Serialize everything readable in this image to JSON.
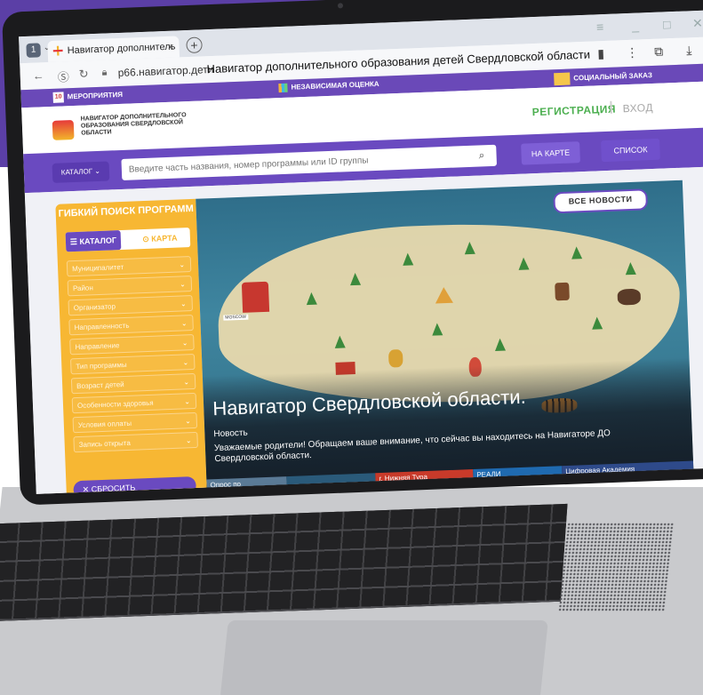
{
  "browser": {
    "tab_title": "Навигатор дополнитель",
    "url": "р66.навигатор.дети",
    "page_title": "Навигатор дополнительного образования детей Свердловской области",
    "tab_close": "×",
    "new_tab": "+"
  },
  "topstrip": {
    "events_day": "10",
    "events": "МЕРОПРИЯТИЯ",
    "independent": "НЕЗАВИСИМАЯ ОЦЕНКА",
    "social": "СОЦИАЛЬНЫЙ ЗАКАЗ"
  },
  "header": {
    "logo_text": "НАВИГАТОР ДОПОЛНИТЕЛЬНОГО ОБРАЗОВАНИЯ СВЕРДЛОВСКОЙ ОБЛАСТИ",
    "register": "РЕГИСТРАЦИЯ",
    "login": "ВХОД"
  },
  "searchbar": {
    "catalog": "КАТАЛОГ ⌄",
    "placeholder": "Введите часть названия, номер программы или ID группы",
    "on_map": "НА КАРТЕ",
    "list": "СПИСОК"
  },
  "sidebar": {
    "title": "ГИБКИЙ ПОИСК ПРОГРАММ",
    "tab_catalog": "☰ КАТАЛОГ",
    "tab_map": "⊙ КАРТА",
    "filters": [
      "Муниципалитет",
      "Район",
      "Организатор",
      "Направленность",
      "Направление",
      "Тип программы",
      "Возраст детей",
      "Особенности здоровья",
      "Условия оплаты",
      "Запись открыта"
    ],
    "reset": "✕  СБРОСИТЬ"
  },
  "banner": {
    "all_news": "ВСЕ НОВОСТИ",
    "title": "Навигатор Свердловской области.",
    "kind": "Новость",
    "text": "Уважаемые родители! Обращаем ваше внимание, что сейчас вы находитесь на Навигаторе ДО Свердловской области.",
    "map_label": "MOSCOW",
    "thumbs": [
      "Опрос по",
      "г. Нижняя Тура",
      "РЕАЛИ",
      "Цифровая Академия"
    ]
  },
  "colors": {
    "purple": "#6a4ac0",
    "orange": "#f7b733",
    "green": "#4caf50"
  }
}
